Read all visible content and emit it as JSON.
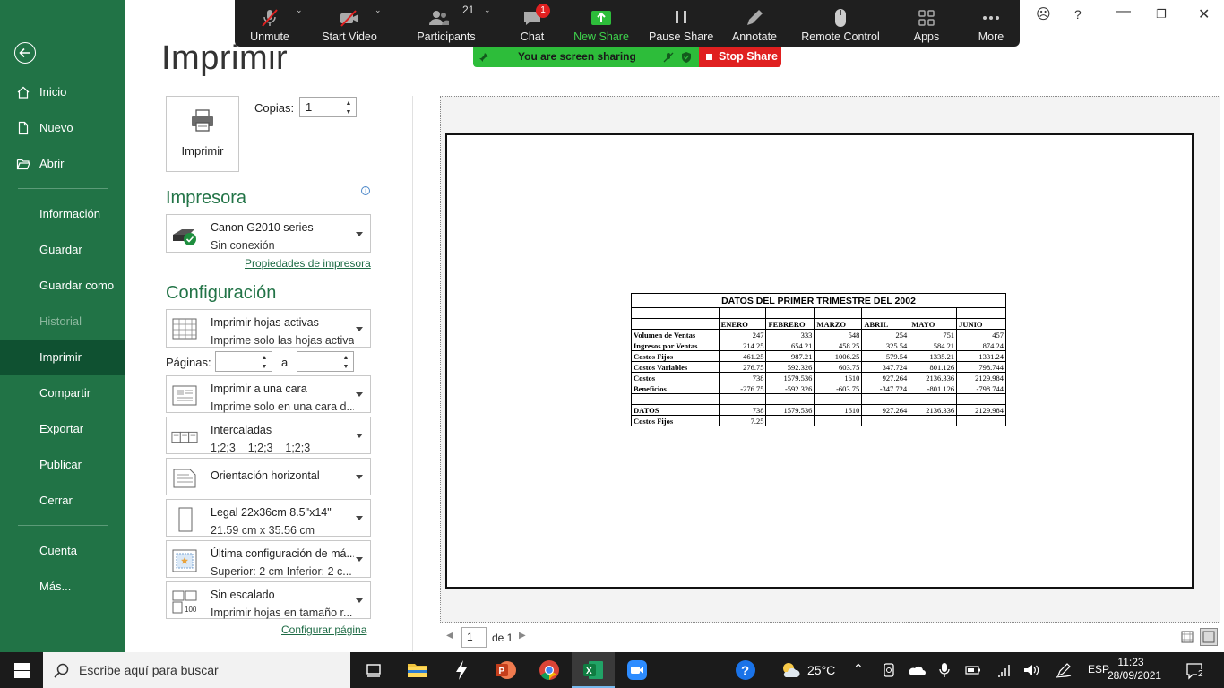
{
  "sidebar": {
    "items": [
      {
        "label": "Inicio"
      },
      {
        "label": "Nuevo"
      },
      {
        "label": "Abrir"
      },
      {
        "label": "Información"
      },
      {
        "label": "Guardar"
      },
      {
        "label": "Guardar como"
      },
      {
        "label": "Historial"
      },
      {
        "label": "Imprimir"
      },
      {
        "label": "Compartir"
      },
      {
        "label": "Exportar"
      },
      {
        "label": "Publicar"
      },
      {
        "label": "Cerrar"
      },
      {
        "label": "Cuenta"
      },
      {
        "label": "Más..."
      }
    ]
  },
  "page": {
    "title": "Imprimir"
  },
  "print": {
    "button_label": "Imprimir",
    "copies_label": "Copias:",
    "copies_value": "1"
  },
  "printer": {
    "heading": "Impresora",
    "name": "Canon G2010 series",
    "status": "Sin conexión",
    "properties_link": "Propiedades de impresora"
  },
  "settings": {
    "heading": "Configuración",
    "what": {
      "l1": "Imprimir hojas activas",
      "l2": "Imprime solo las hojas activas"
    },
    "pages_label": "Páginas:",
    "pages_to": "a",
    "sides": {
      "l1": "Imprimir a una cara",
      "l2": "Imprime solo en una cara d..."
    },
    "collate": {
      "l1": "Intercaladas",
      "l2": "1;2;3    1;2;3    1;2;3"
    },
    "orientation": {
      "l1": "Orientación horizontal"
    },
    "paper": {
      "l1": "Legal 22x36cm 8.5\"x14\"",
      "l2": "21.59 cm x 35.56 cm"
    },
    "margins": {
      "l1": "Última configuración de má...",
      "l2": "Superior: 2 cm Inferior: 2 c..."
    },
    "scaling": {
      "l1": "Sin escalado",
      "l2": "Imprimir hojas en tamaño r..."
    },
    "page_setup_link": "Configurar página"
  },
  "preview": {
    "title": "DATOS DEL PRIMER TRIMESTRE DEL 2002",
    "months": [
      "ENERO",
      "FEBRERO",
      "MARZO",
      "ABRIL",
      "MAYO",
      "JUNIO"
    ],
    "rows": [
      {
        "label": "Volumen de Ventas",
        "values": [
          "247",
          "333",
          "548",
          "254",
          "751",
          "457"
        ]
      },
      {
        "label": "Ingresos por Ventas",
        "values": [
          "214.25",
          "654.21",
          "458.25",
          "325.54",
          "584.21",
          "874.24"
        ]
      },
      {
        "label": "Costos Fijos",
        "values": [
          "461.25",
          "987.21",
          "1006.25",
          "579.54",
          "1335.21",
          "1331.24"
        ]
      },
      {
        "label": "Costos Variables",
        "values": [
          "276.75",
          "592.326",
          "603.75",
          "347.724",
          "801.126",
          "798.744"
        ]
      },
      {
        "label": "Costos",
        "values": [
          "738",
          "1579.536",
          "1610",
          "927.264",
          "2136.336",
          "2129.984"
        ]
      },
      {
        "label": "Beneficios",
        "values": [
          "-276.75",
          "-592.326",
          "-603.75",
          "-347.724",
          "-801.126",
          "-798.744"
        ]
      }
    ],
    "datos_row": {
      "label": "DATOS",
      "values": [
        "738",
        "1579.536",
        "1610",
        "927.264",
        "2136.336",
        "2129.984"
      ]
    },
    "fijos_row": {
      "label": "Costos Fijos",
      "value": "7.25"
    }
  },
  "pager": {
    "current": "1",
    "of_label": "de 1"
  },
  "zoom": {
    "buttons": [
      "Unmute",
      "Start Video",
      "Participants",
      "Chat",
      "New Share",
      "Pause Share",
      "Annotate",
      "Remote Control",
      "Apps",
      "More"
    ],
    "participants_count": "21",
    "chat_badge": "1",
    "sharing_text": "You are screen sharing",
    "stop_share": "Stop Share"
  },
  "taskbar": {
    "search_placeholder": "Escribe aquí para buscar",
    "weather": "25°C",
    "lang": "ESP",
    "time": "11:23",
    "date": "28/09/2021",
    "notif_count": "2"
  }
}
